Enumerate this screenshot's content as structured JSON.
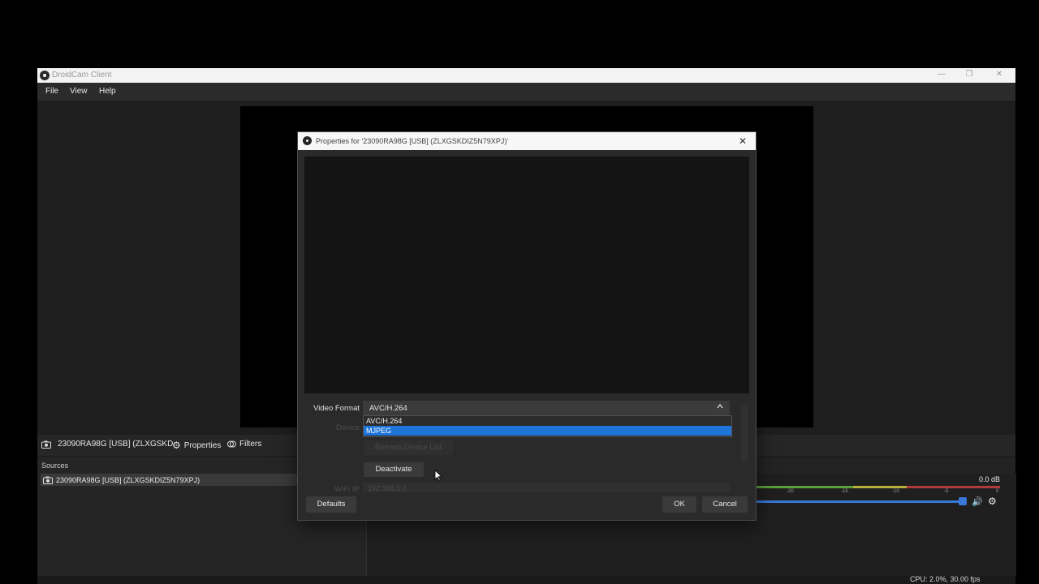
{
  "main_window": {
    "title": "DroidCam Client",
    "window_controls": [
      "—",
      "❐",
      "✕"
    ],
    "menu": [
      "File",
      "View",
      "Help"
    ]
  },
  "source_toolbar": {
    "source_name": "23090RA98G [USB] (ZLXGSKD",
    "properties_label": "Properties",
    "filters_label": "Filters"
  },
  "sources_dock": {
    "header": "Sources",
    "items": [
      "23090RA98G [USB] (ZLXGSKDIZ5N79XPJ)"
    ]
  },
  "mixer": {
    "db_value": "0.0 dB",
    "volume_level": 1.0,
    "ticks": [
      "-20",
      "-15",
      "-10",
      "-5",
      "0"
    ]
  },
  "status": {
    "text": "CPU: 2.0%, 30.00 fps"
  },
  "dialog": {
    "title": "Properties for '23090RA98G [USB] (ZLXGSKDIZ5N79XPJ)'",
    "close_glyph": "✕",
    "video_format": {
      "label": "Video Format",
      "value": "AVC/H.264",
      "options": [
        "AVC/H.264",
        "MJPEG"
      ],
      "highlighted": "MJPEG"
    },
    "device_label": "Device",
    "refresh_label": "Refresh Device List",
    "deactivate_label": "Deactivate",
    "wifi_label": "WiFi IP",
    "wifi_value": "192.168.1.2",
    "defaults_label": "Defaults",
    "ok_label": "OK",
    "cancel_label": "Cancel"
  },
  "colors": {
    "accent": "#1e74d8",
    "meter_green": "#5a9e3c",
    "meter_yellow": "#b8b03a",
    "meter_red": "#b23a3a",
    "slider_blue": "#3a78d8"
  }
}
